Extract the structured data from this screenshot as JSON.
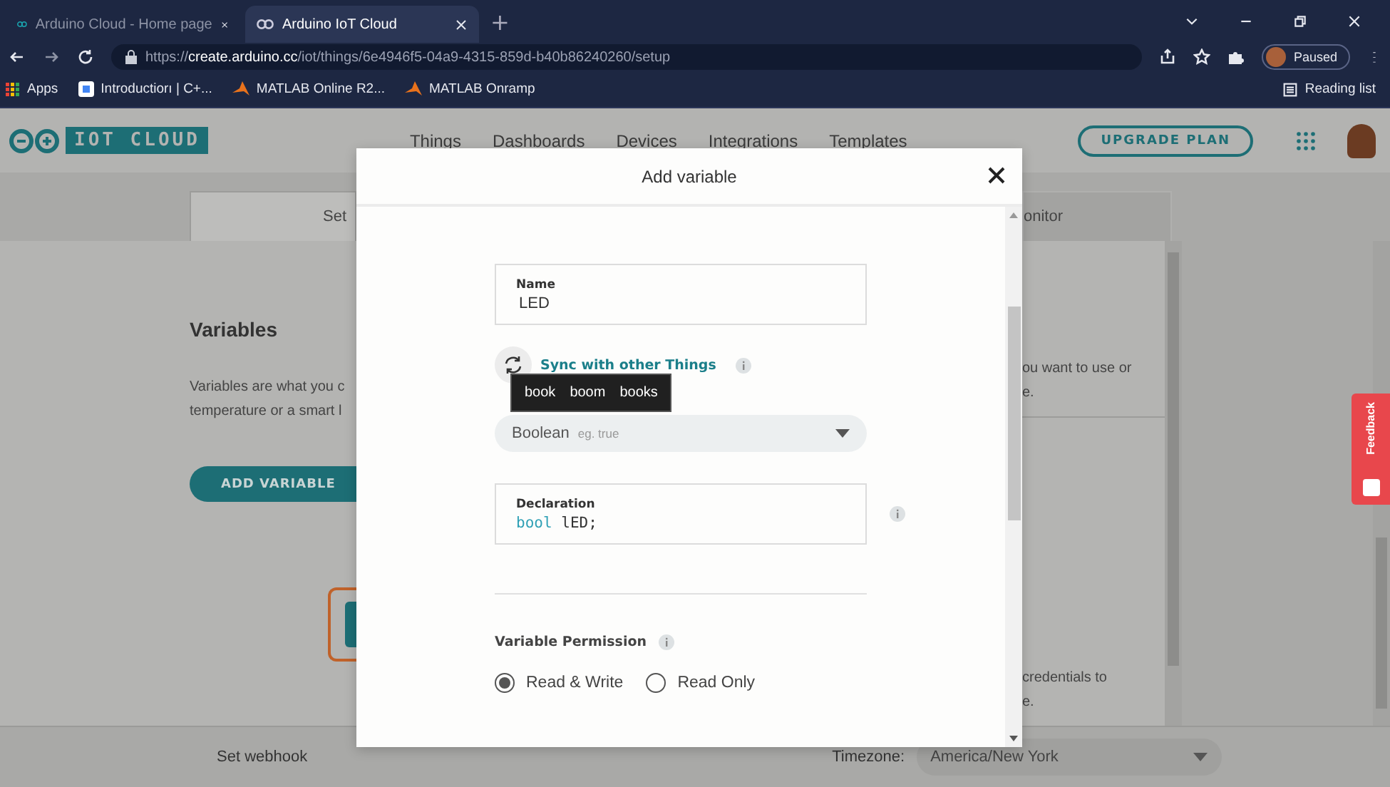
{
  "browser": {
    "tabs": [
      {
        "title": "Arduino Cloud - Home page",
        "selected": false
      },
      {
        "title": "Arduino IoT Cloud",
        "selected": true
      }
    ],
    "new_tab": "+",
    "url": {
      "scheme": "https://",
      "host": "create.arduino.cc",
      "path": "/iot/things/6e4946f5-04a9-4315-859d-b40b86240260/setup"
    },
    "profile": "Paused",
    "bookmarks": [
      {
        "label": "Apps",
        "kind": "apps"
      },
      {
        "label": "Introductiorı | C+...",
        "kind": "page"
      },
      {
        "label": "MATLAB Online R2...",
        "kind": "matlab"
      },
      {
        "label": "MATLAB Onramp",
        "kind": "matlab"
      }
    ],
    "reading_list": "Reading list"
  },
  "app": {
    "logo": "IOT CLOUD",
    "nav": [
      "Things",
      "Dashboards",
      "Devices",
      "Integrations",
      "Templates"
    ],
    "upgrade": "UPGRADE PLAN"
  },
  "page": {
    "tabs": [
      {
        "label": "Set",
        "selected": true
      },
      {
        "label": "onitor",
        "selected": false
      }
    ],
    "variables_title": "Variables",
    "variables_text": [
      "Variables are what you c",
      "temperature or a smart l"
    ],
    "add_variable": "ADD VARIABLE",
    "right_text_1": [
      "ou want to use or",
      "e."
    ],
    "right_text_2": [
      "credentials to",
      "e."
    ],
    "webhook": "Set webhook",
    "timezone_label": "Timezone:",
    "timezone": "America/New York",
    "feedback": "Feedback"
  },
  "dialog": {
    "title": "Add variable",
    "name": {
      "label": "Name",
      "value": "LED"
    },
    "sync": "Sync with other Things",
    "suggestions": [
      "book",
      "boom",
      "books"
    ],
    "type": {
      "value": "Boolean",
      "placeholder": "eg. true"
    },
    "declaration": {
      "label": "Declaration",
      "keyword": "bool",
      "name": "lED",
      "end": ";"
    },
    "permission": {
      "label": "Variable Permission",
      "options": [
        {
          "label": "Read & Write",
          "selected": true
        },
        {
          "label": "Read Only",
          "selected": false
        }
      ]
    }
  }
}
